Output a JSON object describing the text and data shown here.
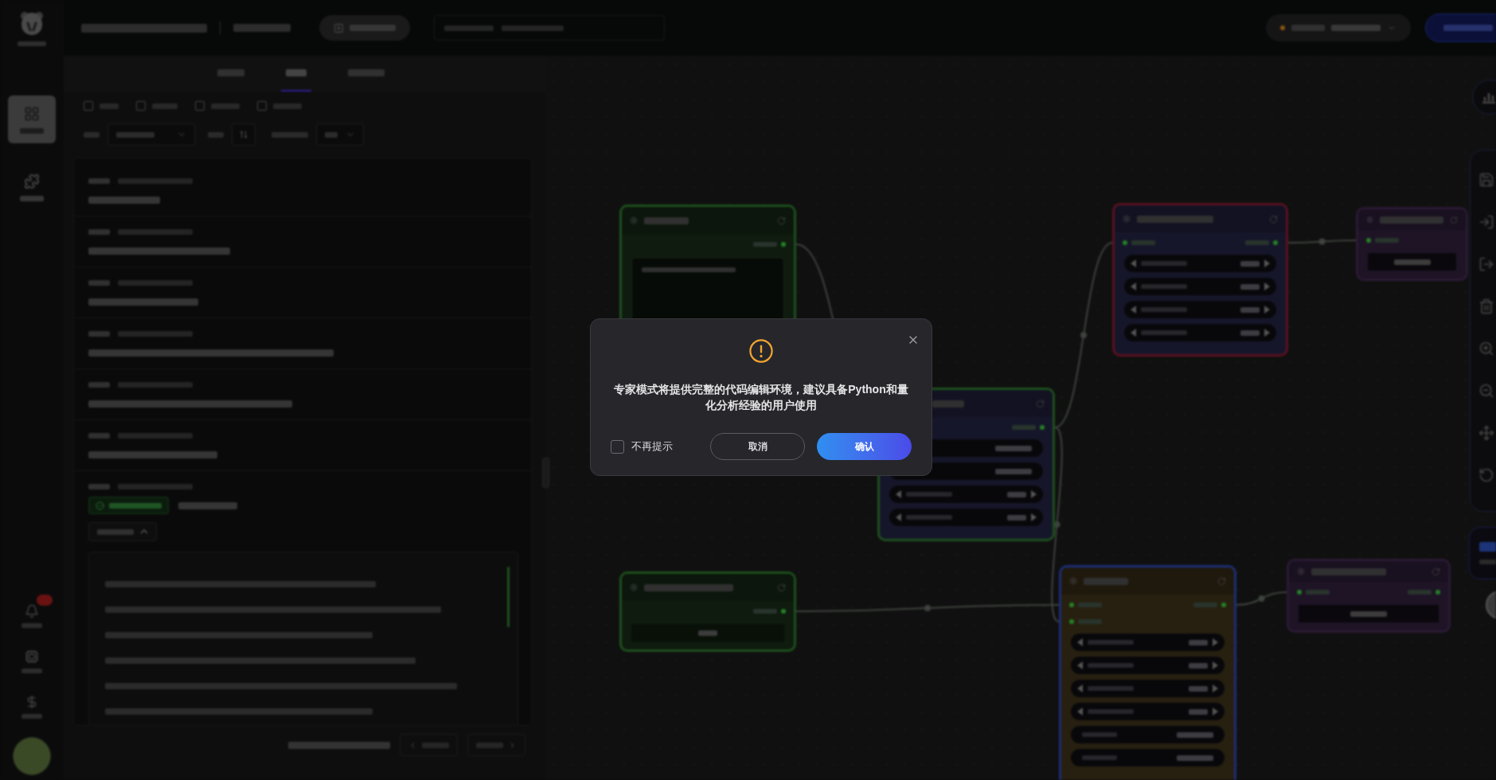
{
  "backdrop": {
    "sidebar": {
      "items": [
        {
          "kind": "workflow",
          "selected": true
        },
        {
          "kind": "plugin",
          "selected": false
        }
      ],
      "bottom_items": [
        {
          "kind": "bell",
          "badge": true
        },
        {
          "kind": "compute",
          "badge": false
        },
        {
          "kind": "wallet",
          "badge": false
        }
      ]
    },
    "log_panel": {
      "tabs": [
        {
          "selected": false
        },
        {
          "selected": true
        },
        {
          "selected": false
        }
      ],
      "levels": [
        {
          "checked": false
        },
        {
          "checked": false
        },
        {
          "checked": false
        },
        {
          "checked": false
        }
      ],
      "entries": [
        {
          "kind": "text"
        },
        {
          "kind": "text"
        },
        {
          "kind": "text"
        },
        {
          "kind": "text"
        },
        {
          "kind": "text"
        },
        {
          "kind": "text"
        },
        {
          "kind": "detail",
          "expanded": true
        }
      ]
    },
    "canvas": {
      "nodes": [
        {
          "kind": "formula",
          "ports": [
            {
              "kind": "out"
            }
          ]
        },
        {
          "kind": "python",
          "ports": [
            {
              "kind": "out"
            }
          ]
        },
        {
          "kind": "factor_build",
          "ports": [
            {
              "kind": "out"
            }
          ],
          "rows": [
            {
              "kind": "value"
            },
            {
              "kind": "value"
            },
            {
              "kind": "stepper"
            },
            {
              "kind": "stepper"
            }
          ]
        },
        {
          "kind": "analysis",
          "ports": [
            {
              "kind": "in"
            },
            {
              "kind": "out"
            }
          ],
          "rows": [
            {
              "kind": "stepper"
            },
            {
              "kind": "stepper"
            },
            {
              "kind": "stepper"
            },
            {
              "kind": "stepper"
            }
          ]
        },
        {
          "kind": "result",
          "ports": [
            {
              "kind": "in"
            }
          ]
        },
        {
          "kind": "backtest",
          "ports": [
            {
              "kind": "in"
            },
            {
              "kind": "in"
            },
            {
              "kind": "out"
            }
          ],
          "rows": [
            {
              "kind": "stepper"
            },
            {
              "kind": "stepper"
            },
            {
              "kind": "stepper"
            },
            {
              "kind": "stepper"
            },
            {
              "kind": "field"
            },
            {
              "kind": "field"
            }
          ]
        },
        {
          "kind": "result",
          "ports": [
            {
              "kind": "in"
            },
            {
              "kind": "out"
            }
          ]
        }
      ]
    }
  },
  "dialog": {
    "message": "专家模式将提供完整的代码编辑环境，建议具备Python和量化分析经验的用户使用",
    "checkbox": {
      "label": "不再提示",
      "checked": false
    },
    "cancel": "取消",
    "confirm": "确认"
  }
}
